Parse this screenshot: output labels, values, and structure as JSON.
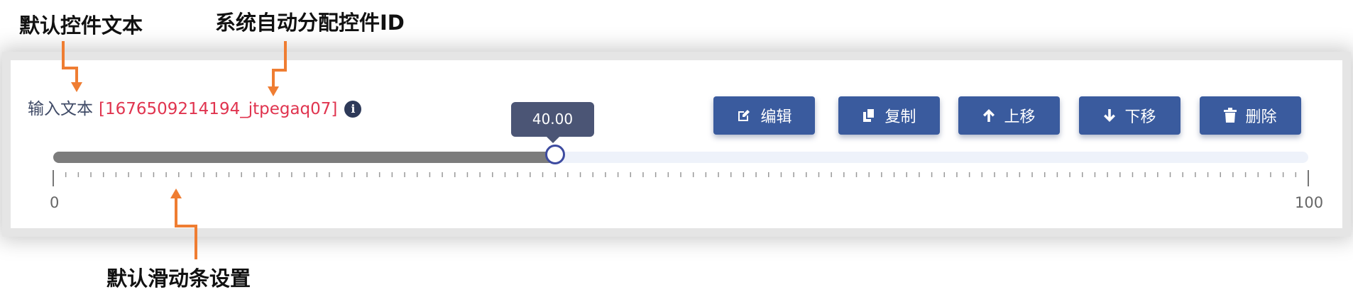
{
  "annotations": {
    "default_text": "默认控件文本",
    "auto_id": "系统自动分配控件ID",
    "slider_settings": "默认滑动条设置"
  },
  "field": {
    "label": "输入文本",
    "control_id": "[1676509214194_jtpegaq07]"
  },
  "toolbar": {
    "edit": "编辑",
    "copy": "复制",
    "move_up": "上移",
    "move_down": "下移",
    "delete": "删除"
  },
  "slider": {
    "value": 40,
    "value_display": "40.00",
    "min": 0,
    "max": 100,
    "min_label": "0",
    "max_label": "100",
    "fill_color": "#7c7c7c",
    "thumb_color": "#3d4ba0"
  },
  "colors": {
    "annotation_arrow": "#ef7d32",
    "button": "#3a5b9e",
    "id_text": "#e0344f"
  },
  "icons": [
    "edit-icon",
    "copy-icon",
    "arrow-up-icon",
    "arrow-down-icon",
    "trash-icon",
    "info-icon"
  ]
}
